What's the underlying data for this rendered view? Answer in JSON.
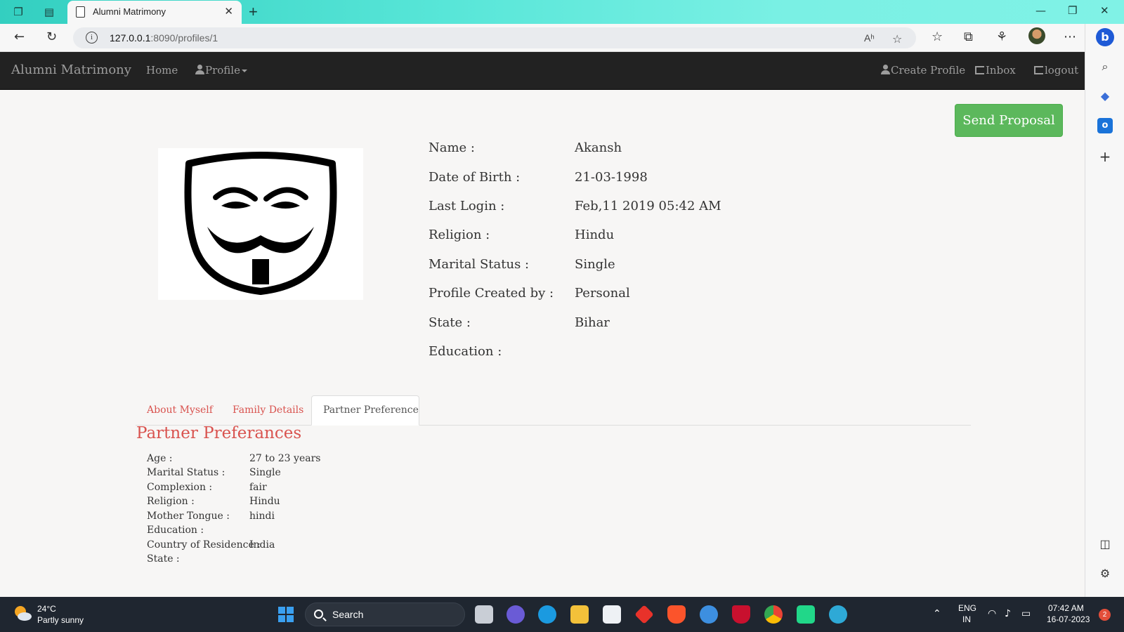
{
  "browser": {
    "tab_title": "Alumni Matrimony",
    "url_host": "127.0.0.1",
    "url_rest": ":8090/profiles/1"
  },
  "navbar": {
    "brand": "Alumni Matrimony",
    "home": "Home",
    "profile": "Profile",
    "create_profile": "Create Profile",
    "inbox": "Inbox",
    "logout": "logout"
  },
  "actions": {
    "send_proposal": "Send Proposal"
  },
  "profile": {
    "fields": [
      {
        "label": "Name :",
        "value": "Akansh"
      },
      {
        "label": "Date of Birth :",
        "value": "21-03-1998"
      },
      {
        "label": "Last Login :",
        "value": "Feb,11 2019 05:42 AM"
      },
      {
        "label": "Religion :",
        "value": "Hindu"
      },
      {
        "label": "Marital Status :",
        "value": "Single"
      },
      {
        "label": "Profile Created by :",
        "value": "Personal"
      },
      {
        "label": "State :",
        "value": "Bihar"
      },
      {
        "label": "Education :",
        "value": ""
      }
    ]
  },
  "tabs": [
    "About Myself",
    "Family Details",
    "Partner Preference"
  ],
  "partner": {
    "title": "Partner Preferances",
    "fields": [
      {
        "label": "Age :",
        "value": "27 to 23 years"
      },
      {
        "label": "Marital Status :",
        "value": "Single"
      },
      {
        "label": "Complexion :",
        "value": "fair"
      },
      {
        "label": "Religion :",
        "value": "Hindu"
      },
      {
        "label": "Mother Tongue :",
        "value": "hindi"
      },
      {
        "label": "Education :",
        "value": ""
      },
      {
        "label": "Country of Residence :",
        "value": "India"
      },
      {
        "label": "State :",
        "value": ""
      }
    ]
  },
  "taskbar": {
    "weather_temp": "24°C",
    "weather_desc": "Partly sunny",
    "search": "Search",
    "lang_1": "ENG",
    "lang_2": "IN",
    "time": "07:42 AM",
    "date": "16-07-2023",
    "notifications": "2"
  },
  "colors": {
    "navbar_bg": "#222222",
    "send_btn": "#5cb85c",
    "tab_accent": "#d9534f"
  }
}
